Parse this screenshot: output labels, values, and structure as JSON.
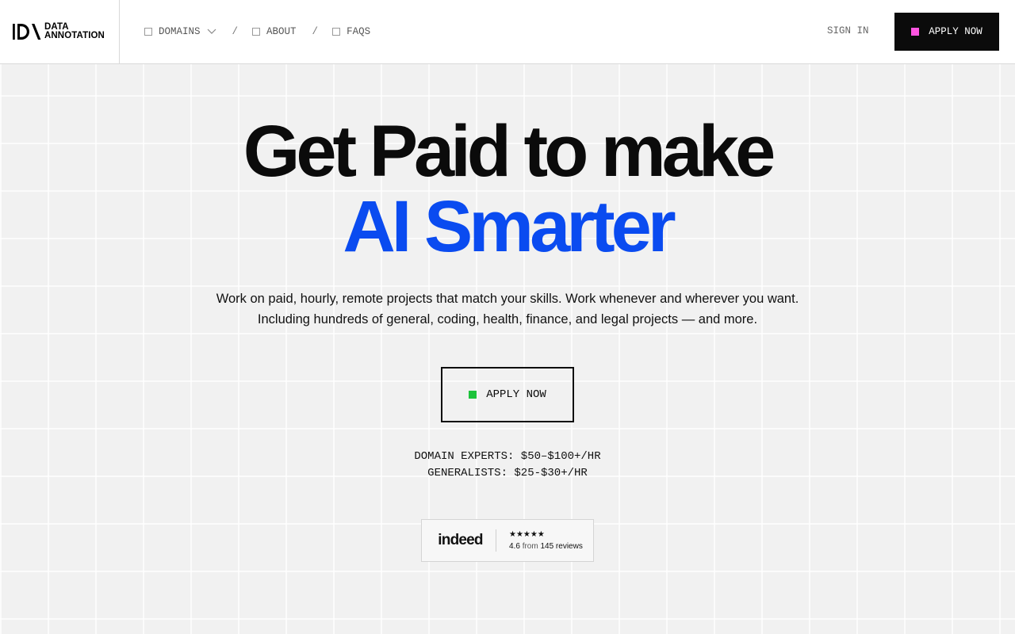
{
  "brand": {
    "line1": "DATA",
    "line2": "ANNOTATION"
  },
  "nav": {
    "items": [
      {
        "label": "DOMAINS"
      },
      {
        "label": "ABOUT"
      },
      {
        "label": "FAQS"
      }
    ],
    "separator": "/"
  },
  "header": {
    "sign_in": "SIGN IN",
    "apply_label": "APPLY NOW"
  },
  "hero": {
    "line1": "Get Paid to make",
    "line2": "AI Smarter",
    "sub1": "Work on paid, hourly, remote projects that match your skills. Work whenever and wherever you want.",
    "sub2": "Including hundreds of general, coding, health, finance, and legal projects — and more.",
    "apply_label": "APPLY NOW",
    "rate1": "DOMAIN EXPERTS: $50–$100+/HR",
    "rate2": "GENERALISTS: $25-$30+/HR"
  },
  "review": {
    "source": "indeed",
    "stars": "★★★★★",
    "score": "4.6",
    "from": "from",
    "count": "145 reviews"
  },
  "colors": {
    "accent_blue": "#0a4bf0",
    "pink": "#ff55e1",
    "green": "#1dc33b",
    "black": "#0b0b0b"
  }
}
